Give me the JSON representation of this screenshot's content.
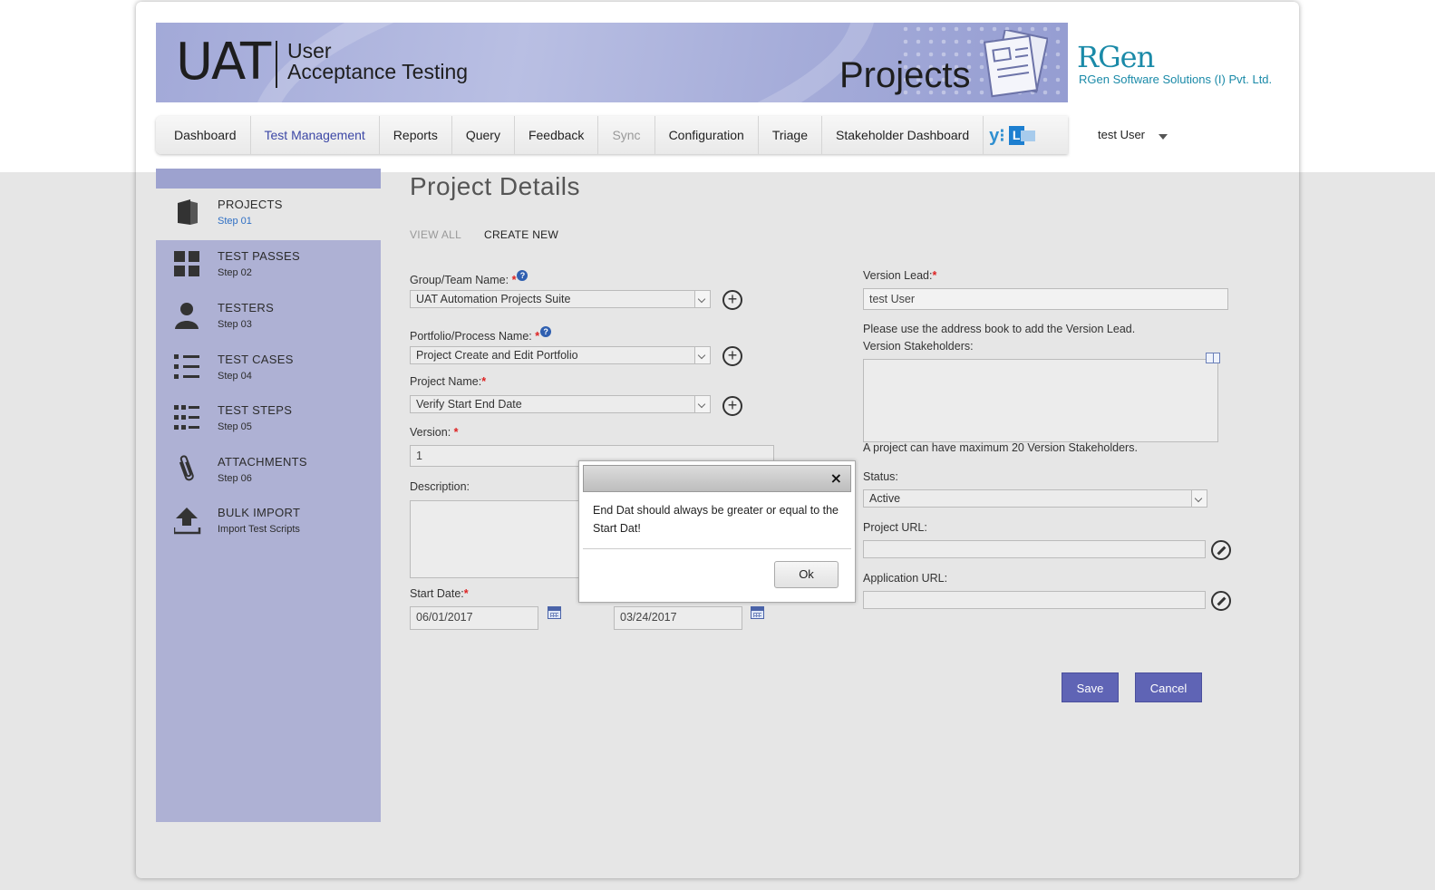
{
  "banner": {
    "uat": "UAT",
    "subtitle_line1": "User",
    "subtitle_line2": "Acceptance Testing",
    "section": "Projects"
  },
  "company": {
    "logo": "RGen",
    "name": "RGen Software Solutions (I) Pvt. Ltd."
  },
  "nav": {
    "items": [
      {
        "label": "Dashboard",
        "state": "normal"
      },
      {
        "label": "Test Management",
        "state": "active"
      },
      {
        "label": "Reports",
        "state": "normal"
      },
      {
        "label": "Query",
        "state": "normal"
      },
      {
        "label": "Feedback",
        "state": "normal"
      },
      {
        "label": "Sync",
        "state": "disabled"
      },
      {
        "label": "Configuration",
        "state": "normal"
      },
      {
        "label": "Triage",
        "state": "normal"
      },
      {
        "label": "Stakeholder Dashboard",
        "state": "normal"
      }
    ],
    "icons": [
      "yammer-icon",
      "lync-icon"
    ],
    "user": "test User"
  },
  "sidebar": {
    "items": [
      {
        "title": "PROJECTS",
        "step": "Step 01",
        "icon": "projects-icon"
      },
      {
        "title": "TEST PASSES",
        "step": "Step 02",
        "icon": "grid-icon"
      },
      {
        "title": "TESTERS",
        "step": "Step 03",
        "icon": "person-icon"
      },
      {
        "title": "TEST CASES",
        "step": "Step 04",
        "icon": "list-icon"
      },
      {
        "title": "TEST STEPS",
        "step": "Step 05",
        "icon": "steps-icon"
      },
      {
        "title": "ATTACHMENTS",
        "step": "Step 06",
        "icon": "paperclip-icon"
      },
      {
        "title": "BULK IMPORT",
        "step": "Import Test Scripts",
        "icon": "upload-icon"
      }
    ]
  },
  "main": {
    "title": "Project Details",
    "tabs": {
      "view_all": "VIEW ALL",
      "create_new": "CREATE NEW"
    },
    "form": {
      "group_label": "Group/Team Name:",
      "group_value": "UAT Automation Projects Suite",
      "portfolio_label": "Portfolio/Process Name:",
      "portfolio_value": "Project Create and Edit Portfolio",
      "project_label": "Project Name:",
      "project_value": "Verify Start End Date",
      "version_label": "Version:",
      "version_value": "1",
      "description_label": "Description:",
      "start_label": "Start Date:",
      "start_value": "06/01/2017",
      "end_value": "03/24/2017",
      "version_lead_label": "Version Lead:",
      "version_lead_value": "test User",
      "address_book_note": "Please use the address book to add the Version Lead.",
      "stakeholders_label": "Version Stakeholders:",
      "stakeholders_note": "A project can have maximum 20 Version Stakeholders.",
      "status_label": "Status:",
      "status_value": "Active",
      "project_url_label": "Project URL:",
      "application_url_label": "Application URL:",
      "required_mark": "*",
      "help_mark": "?",
      "plus_mark": "+"
    },
    "buttons": {
      "save": "Save",
      "cancel": "Cancel"
    }
  },
  "dialog": {
    "close": "×",
    "message": "End Dat should always be greater or equal to the Start Dat!",
    "ok": "Ok"
  }
}
